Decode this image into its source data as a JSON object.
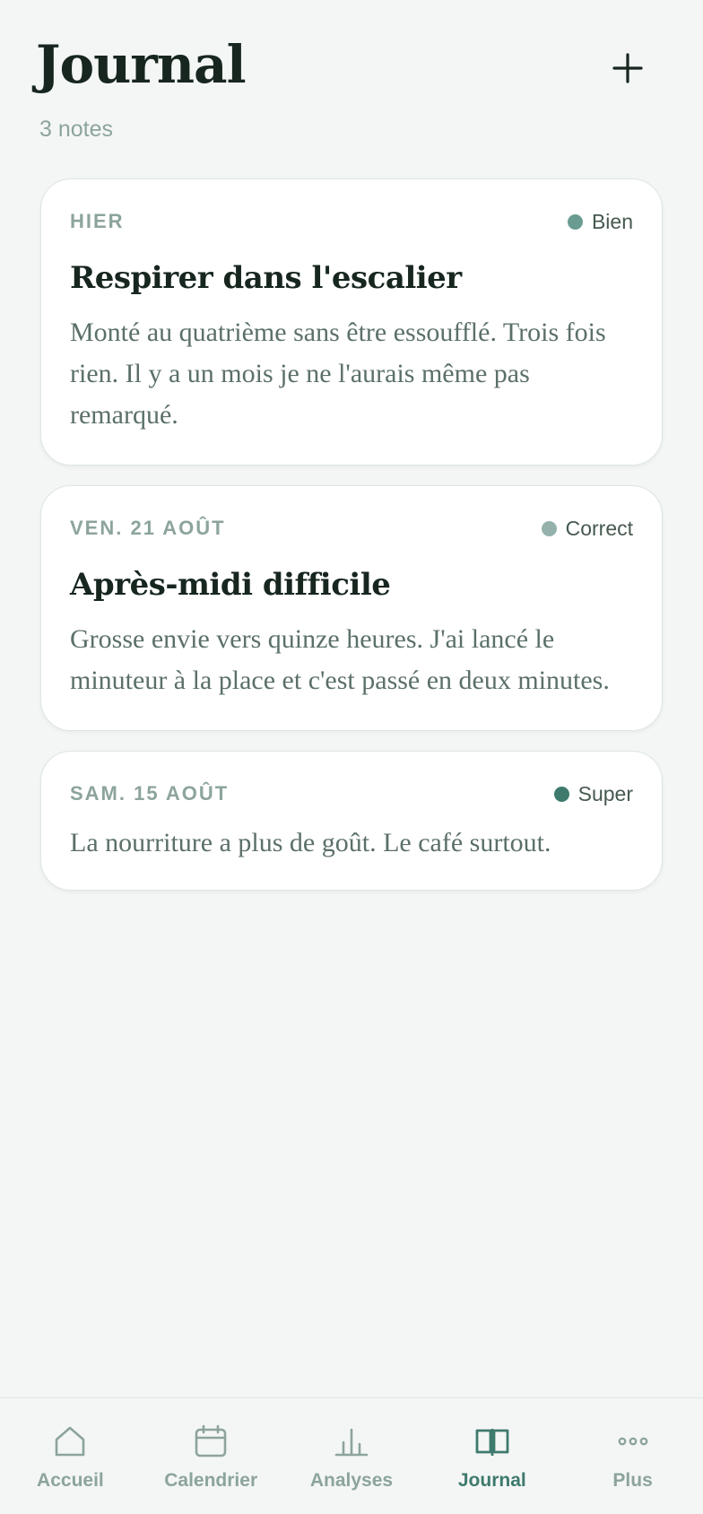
{
  "header": {
    "title": "Journal",
    "subtitle": "3 notes",
    "add_icon": "plus-icon"
  },
  "entries": [
    {
      "date": "HIER",
      "mood": "Bien",
      "mood_color": "#6a9b91",
      "title": "Respirer dans l'escalier",
      "body": "Monté au quatrième sans être essoufflé. Trois fois rien. Il y a un mois je ne l'aurais même pas remarqué."
    },
    {
      "date": "VEN. 21 AOÛT",
      "mood": "Correct",
      "mood_color": "#94b2ab",
      "title": "Après-midi difficile",
      "body": "Grosse envie vers quinze heures. J'ai lancé le minuteur à la place et c'est passé en deux minutes."
    },
    {
      "date": "SAM. 15 AOÛT",
      "mood": "Super",
      "mood_color": "#3e7a6d",
      "title": "",
      "body": "La nourriture a plus de goût. Le café surtout."
    }
  ],
  "tabs": [
    {
      "label": "Accueil",
      "icon": "home-icon",
      "active": false
    },
    {
      "label": "Calendrier",
      "icon": "calendar-icon",
      "active": false
    },
    {
      "label": "Analyses",
      "icon": "bar-chart-icon",
      "active": false
    },
    {
      "label": "Journal",
      "icon": "book-icon",
      "active": true
    },
    {
      "label": "Plus",
      "icon": "more-icon",
      "active": false
    }
  ],
  "colors": {
    "accent": "#3e7a6d",
    "muted": "#8ca49d",
    "text": "#17261f",
    "background": "#f4f6f5"
  }
}
